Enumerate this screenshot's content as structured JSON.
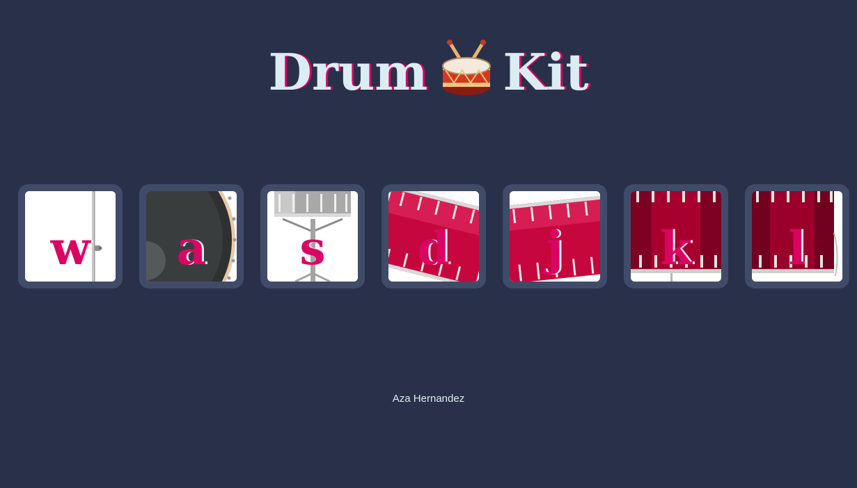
{
  "header": {
    "title_left": "Drum",
    "title_right": "Kit",
    "icon": "drum-with-drumsticks-icon"
  },
  "pads": [
    {
      "key": "w",
      "image": "hi-hat-stand"
    },
    {
      "key": "a",
      "image": "bass-drum"
    },
    {
      "key": "s",
      "image": "snare-drum"
    },
    {
      "key": "d",
      "image": "tom-1"
    },
    {
      "key": "j",
      "image": "tom-2"
    },
    {
      "key": "k",
      "image": "tom-3"
    },
    {
      "key": "l",
      "image": "tom-4"
    }
  ],
  "footer": {
    "text": "Aza Hernandez"
  },
  "colors": {
    "background": "#283149",
    "pad_border": "#404B69",
    "accent": "#DA0463",
    "text": "#DBEDF3"
  }
}
